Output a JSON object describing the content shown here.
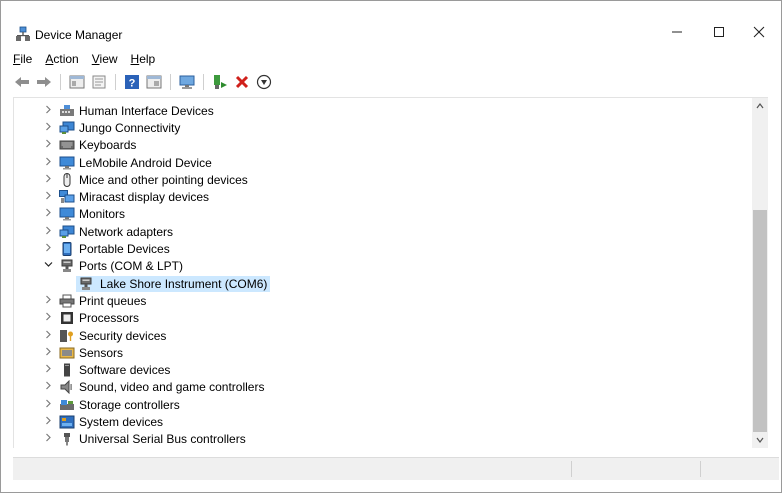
{
  "window": {
    "title": "Device Manager"
  },
  "window_controls": {
    "minimize": "—",
    "maximize": "☐",
    "close": "✕"
  },
  "menu": [
    {
      "underline": "F",
      "rest": "ile"
    },
    {
      "underline": "A",
      "rest": "ction"
    },
    {
      "underline": "V",
      "rest": "iew"
    },
    {
      "underline": "H",
      "rest": "elp"
    }
  ],
  "toolbar": {
    "buttons": [
      "back-icon",
      "forward-icon",
      "properties-icon",
      "update-driver-icon",
      "help-icon",
      "show-hidden-icon",
      "scan-hardware-icon",
      "enable-device-icon",
      "uninstall-icon",
      "download-icon"
    ]
  },
  "tree": {
    "items": [
      {
        "label": "Human Interface Devices",
        "expanded": false,
        "icon": "hid-icon"
      },
      {
        "label": "Jungo Connectivity",
        "expanded": false,
        "icon": "network-icon"
      },
      {
        "label": "Keyboards",
        "expanded": false,
        "icon": "keyboard-icon"
      },
      {
        "label": "LeMobile Android Device",
        "expanded": false,
        "icon": "monitor-icon"
      },
      {
        "label": "Mice and other pointing devices",
        "expanded": false,
        "icon": "mouse-icon"
      },
      {
        "label": "Miracast display devices",
        "expanded": false,
        "icon": "miracast-icon"
      },
      {
        "label": "Monitors",
        "expanded": false,
        "icon": "monitor-icon"
      },
      {
        "label": "Network adapters",
        "expanded": false,
        "icon": "network-icon"
      },
      {
        "label": "Portable Devices",
        "expanded": false,
        "icon": "portable-icon"
      },
      {
        "label": "Ports (COM & LPT)",
        "expanded": true,
        "icon": "port-icon"
      },
      {
        "label": "Lake Shore Instrument (COM6)",
        "child": true,
        "selected": true,
        "icon": "port-icon"
      },
      {
        "label": "Print queues",
        "expanded": false,
        "icon": "printer-icon"
      },
      {
        "label": "Processors",
        "expanded": false,
        "icon": "processor-icon"
      },
      {
        "label": "Security devices",
        "expanded": false,
        "icon": "security-icon"
      },
      {
        "label": "Sensors",
        "expanded": false,
        "icon": "sensor-icon"
      },
      {
        "label": "Software devices",
        "expanded": false,
        "icon": "software-icon"
      },
      {
        "label": "Sound, video and game controllers",
        "expanded": false,
        "icon": "sound-icon"
      },
      {
        "label": "Storage controllers",
        "expanded": false,
        "icon": "storage-icon"
      },
      {
        "label": "System devices",
        "expanded": false,
        "icon": "system-icon"
      },
      {
        "label": "Universal Serial Bus controllers",
        "expanded": false,
        "icon": "usb-icon"
      }
    ]
  },
  "colors": {
    "selection": "#cce8ff",
    "accent": "#1e6fc9"
  }
}
